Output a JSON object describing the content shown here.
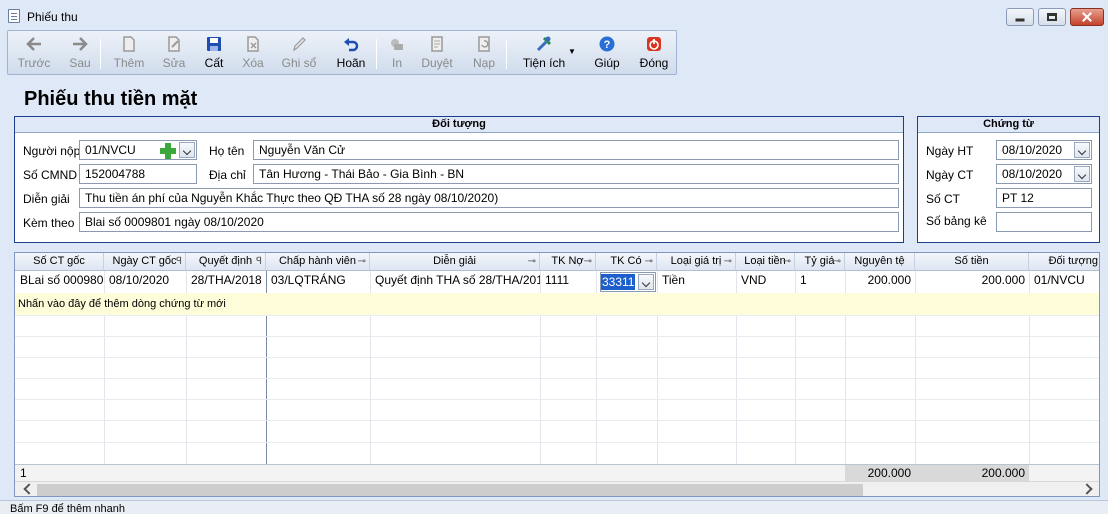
{
  "window": {
    "title": "Phiếu thu"
  },
  "toolbar": {
    "back": "Trước",
    "next": "Sau",
    "add": "Thêm",
    "edit": "Sửa",
    "save": "Cất",
    "delete": "Xóa",
    "post": "Ghi sổ",
    "undo": "Hoãn",
    "print": "In",
    "approve": "Duyệt",
    "load": "Nạp",
    "utilities": "Tiện ích",
    "help": "Giúp",
    "close": "Đóng"
  },
  "page_title": "Phiếu thu tiền mặt",
  "doi_tuong": {
    "header": "Đối tượng",
    "nguoi_nop_label": "Người nộp",
    "nguoi_nop": "01/NVCU",
    "ho_ten_label": "Họ tên",
    "ho_ten": "Nguyễn Văn Cử",
    "cmnd_label": "Số CMND",
    "cmnd": "152004788",
    "dia_chi_label": "Địa chỉ",
    "dia_chi": "Tân Hương - Thái Bảo - Gia Bình - BN",
    "dien_giai_label": "Diễn giải",
    "dien_giai": "Thu tiền án phí của Nguyễn Khắc Thực  theo QĐ THA số 28 ngày 08/10/2020)",
    "kem_theo_label": "Kèm theo",
    "kem_theo": "Blai số 0009801 ngày 08/10/2020"
  },
  "chung_tu": {
    "header": "Chứng từ",
    "ngay_ht_label": "Ngày HT",
    "ngay_ht": "08/10/2020",
    "ngay_ct_label": "Ngày CT",
    "ngay_ct": "08/10/2020",
    "so_ct_label": "Số CT",
    "so_ct": "PT 12",
    "so_bang_ke_label": "Số bảng kê",
    "so_bang_ke": ""
  },
  "grid": {
    "columns": [
      "Số CT gốc",
      "Ngày CT gốc",
      "Quyết định",
      "Chấp hành viên",
      "Diễn giải",
      "TK Nợ",
      "TK Có",
      "Loại giá trị",
      "Loại tiền",
      "Tỷ giá",
      "Nguyên tệ",
      "Số tiền",
      "Đối tượng"
    ],
    "row": {
      "so_ct_goc": "BLai số 000980",
      "ngay_ct_goc": "08/10/2020",
      "quyet_dinh": "28/THA/2018",
      "chap_hanh_vien": "03/LQTRÁNG",
      "dien_giai": "Quyết định THA số 28/THA/201",
      "tk_no": "1111",
      "tk_co": "33311",
      "loai_gia_tri": "Tiền",
      "loai_tien": "VND",
      "ty_gia": "1",
      "nguyen_te": "200.000",
      "so_tien": "200.000",
      "doi_tuong": "01/NVCU"
    },
    "add_row_hint": "Nhấn vào đây để thêm dòng chứng từ mới",
    "footer": {
      "count": "1",
      "total_nguyen_te": "200.000",
      "total_so_tien": "200.000"
    }
  },
  "status": "Bấm F9 để thêm nhanh"
}
